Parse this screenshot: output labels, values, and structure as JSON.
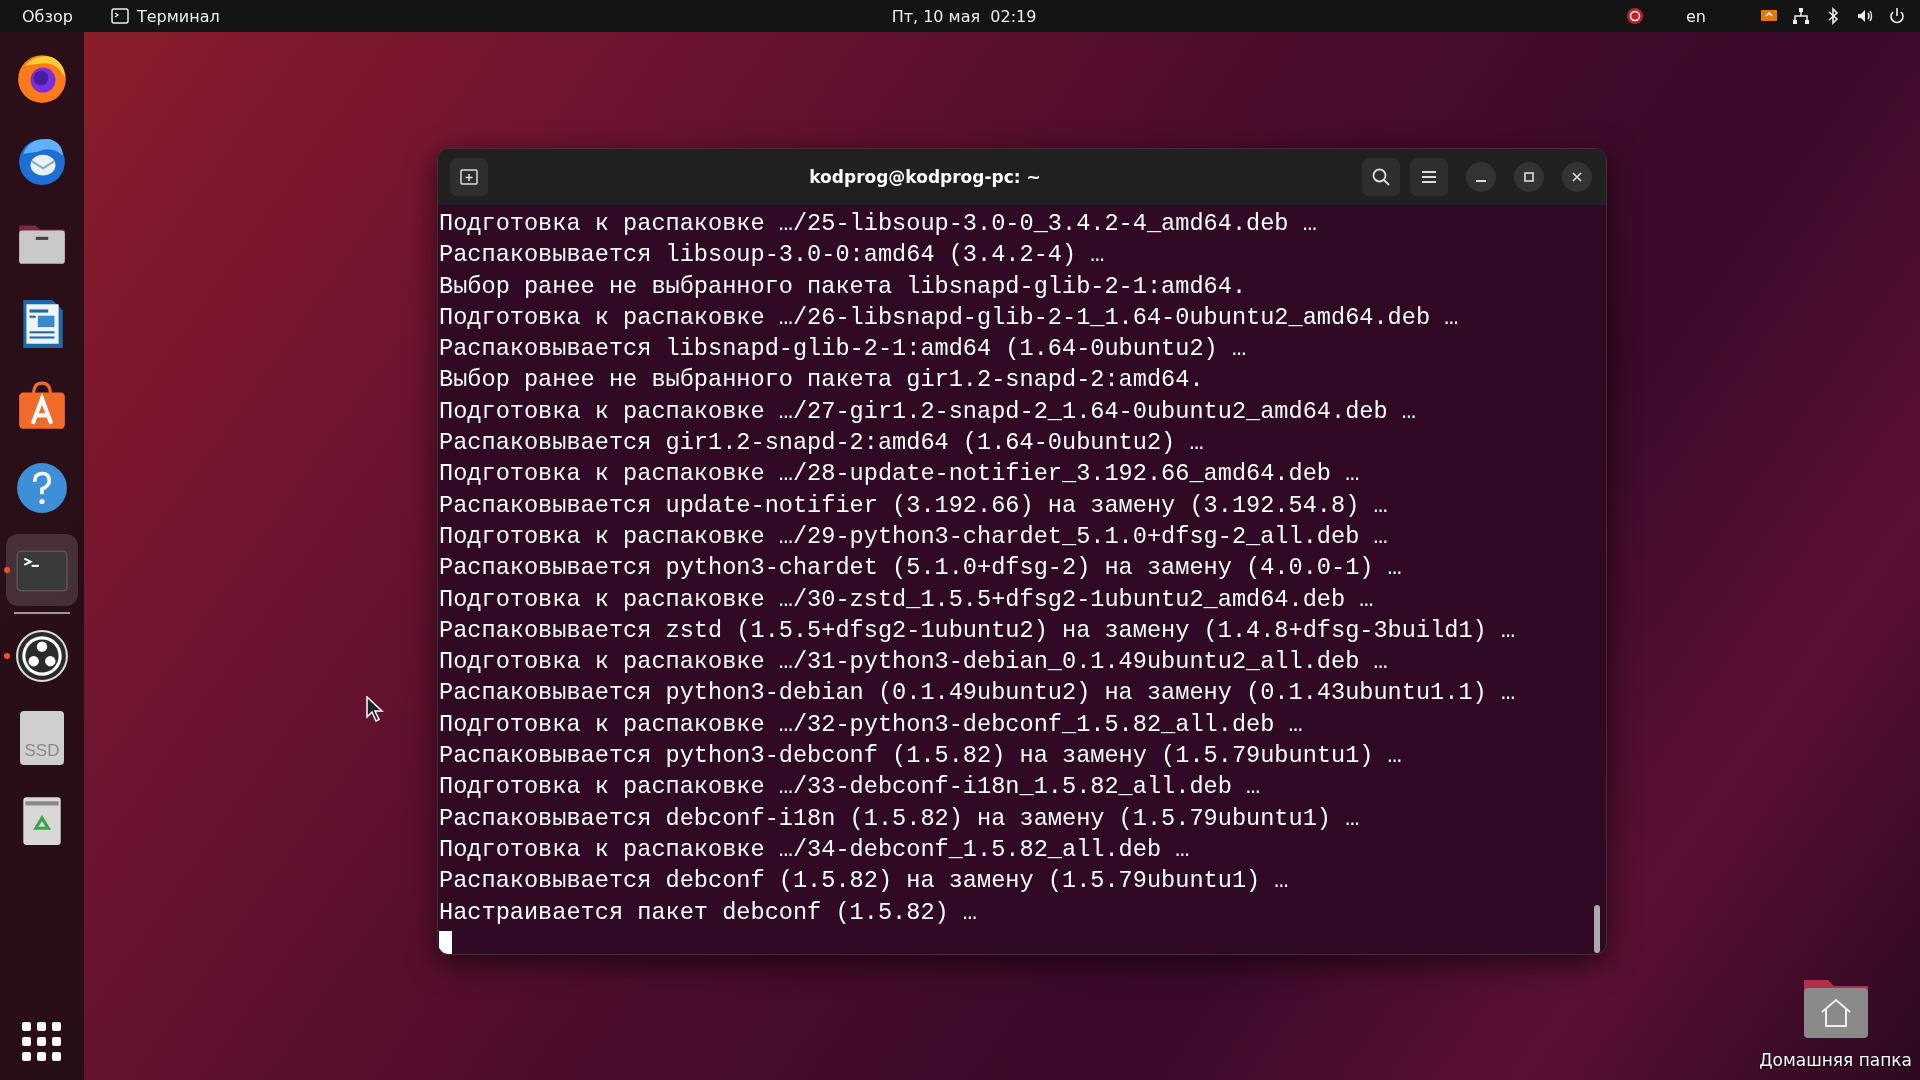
{
  "top_bar": {
    "activities": "Обзор",
    "app_menu": "Терминал",
    "clock": "Пт, 10 мая  02:19",
    "keyboard_layout": "en"
  },
  "dock": {
    "items": [
      {
        "kind": "browser",
        "running": false,
        "selected": false
      },
      {
        "kind": "mail",
        "running": false,
        "selected": false
      },
      {
        "kind": "files",
        "running": false,
        "selected": false
      },
      {
        "kind": "writer",
        "running": false,
        "selected": false
      },
      {
        "kind": "software",
        "running": false,
        "selected": false
      },
      {
        "kind": "help",
        "running": false,
        "selected": false
      },
      {
        "kind": "terminal",
        "running": true,
        "selected": true
      },
      {
        "kind": "separator"
      },
      {
        "kind": "obs",
        "running": true,
        "selected": false
      },
      {
        "kind": "drive",
        "label": "SSD",
        "running": false,
        "selected": false
      },
      {
        "kind": "trash",
        "running": false,
        "selected": false
      }
    ]
  },
  "terminal": {
    "title": "kodprog@kodprog-pc: ~",
    "lines": [
      "Подготовка к распаковке …/25-libsoup-3.0-0_3.4.2-4_amd64.deb …",
      "Распаковывается libsoup-3.0-0:amd64 (3.4.2-4) …",
      "Выбор ранее не выбранного пакета libsnapd-glib-2-1:amd64.",
      "Подготовка к распаковке …/26-libsnapd-glib-2-1_1.64-0ubuntu2_amd64.deb …",
      "Распаковывается libsnapd-glib-2-1:amd64 (1.64-0ubuntu2) …",
      "Выбор ранее не выбранного пакета gir1.2-snapd-2:amd64.",
      "Подготовка к распаковке …/27-gir1.2-snapd-2_1.64-0ubuntu2_amd64.deb …",
      "Распаковывается gir1.2-snapd-2:amd64 (1.64-0ubuntu2) …",
      "Подготовка к распаковке …/28-update-notifier_3.192.66_amd64.deb …",
      "Распаковывается update-notifier (3.192.66) на замену (3.192.54.8) …",
      "Подготовка к распаковке …/29-python3-chardet_5.1.0+dfsg-2_all.deb …",
      "Распаковывается python3-chardet (5.1.0+dfsg-2) на замену (4.0.0-1) …",
      "Подготовка к распаковке …/30-zstd_1.5.5+dfsg2-1ubuntu2_amd64.deb …",
      "Распаковывается zstd (1.5.5+dfsg2-1ubuntu2) на замену (1.4.8+dfsg-3build1) …",
      "Подготовка к распаковке …/31-python3-debian_0.1.49ubuntu2_all.deb …",
      "Распаковывается python3-debian (0.1.49ubuntu2) на замену (0.1.43ubuntu1.1) …",
      "Подготовка к распаковке …/32-python3-debconf_1.5.82_all.deb …",
      "Распаковывается python3-debconf (1.5.82) на замену (1.5.79ubuntu1) …",
      "Подготовка к распаковке …/33-debconf-i18n_1.5.82_all.deb …",
      "Распаковывается debconf-i18n (1.5.82) на замену (1.5.79ubuntu1) …",
      "Подготовка к распаковке …/34-debconf_1.5.82_all.deb …",
      "Распаковывается debconf (1.5.82) на замену (1.5.79ubuntu1) …",
      "Настраивается пакет debconf (1.5.82) …"
    ]
  },
  "desktop": {
    "home_folder": "Домашняя папка"
  }
}
